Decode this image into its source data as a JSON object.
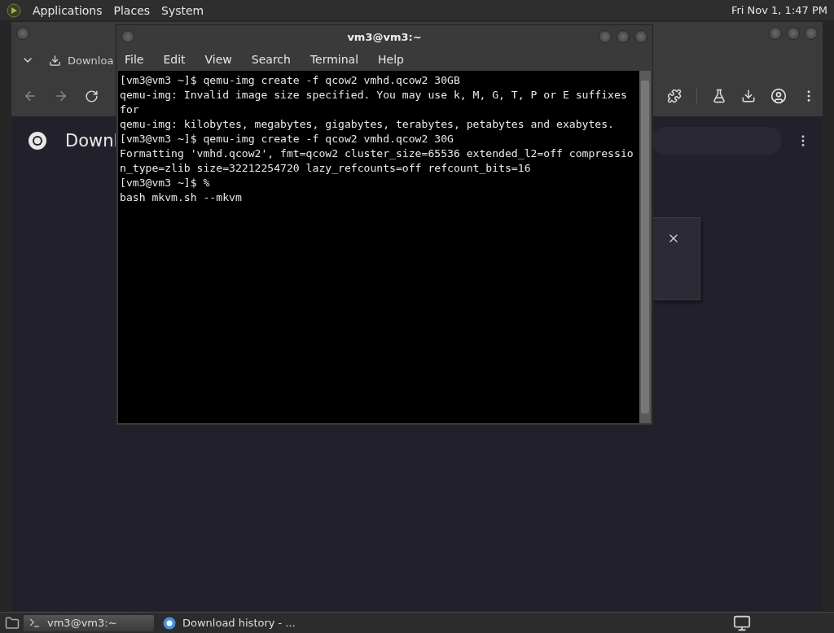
{
  "top_panel": {
    "menus": [
      "Applications",
      "Places",
      "System"
    ],
    "clock": "Fri Nov 1, 1:47 PM"
  },
  "browser": {
    "tab_label": "Downloa",
    "page_heading": "Downl"
  },
  "terminal": {
    "title": "vm3@vm3:~",
    "menus": [
      "File",
      "Edit",
      "View",
      "Search",
      "Terminal",
      "Help"
    ],
    "lines": [
      "[vm3@vm3 ~]$ qemu-img create -f qcow2 vmhd.qcow2 30GB",
      "qemu-img: Invalid image size specified. You may use k, M, G, T, P or E suffixes",
      "for",
      "qemu-img: kilobytes, megabytes, gigabytes, terabytes, petabytes and exabytes.",
      "[vm3@vm3 ~]$ qemu-img create -f qcow2 vmhd.qcow2 30G",
      "Formatting 'vmhd.qcow2', fmt=qcow2 cluster_size=65536 extended_l2=off compressio",
      "n_type=zlib size=32212254720 lazy_refcounts=off refcount_bits=16",
      "[vm3@vm3 ~]$ %",
      "bash mkvm.sh --mkvm"
    ]
  },
  "taskbar": {
    "items": [
      {
        "kind": "terminal",
        "label": "vm3@vm3:~",
        "selected": true
      },
      {
        "kind": "browser",
        "label": "Download history - ...",
        "selected": false
      }
    ]
  }
}
